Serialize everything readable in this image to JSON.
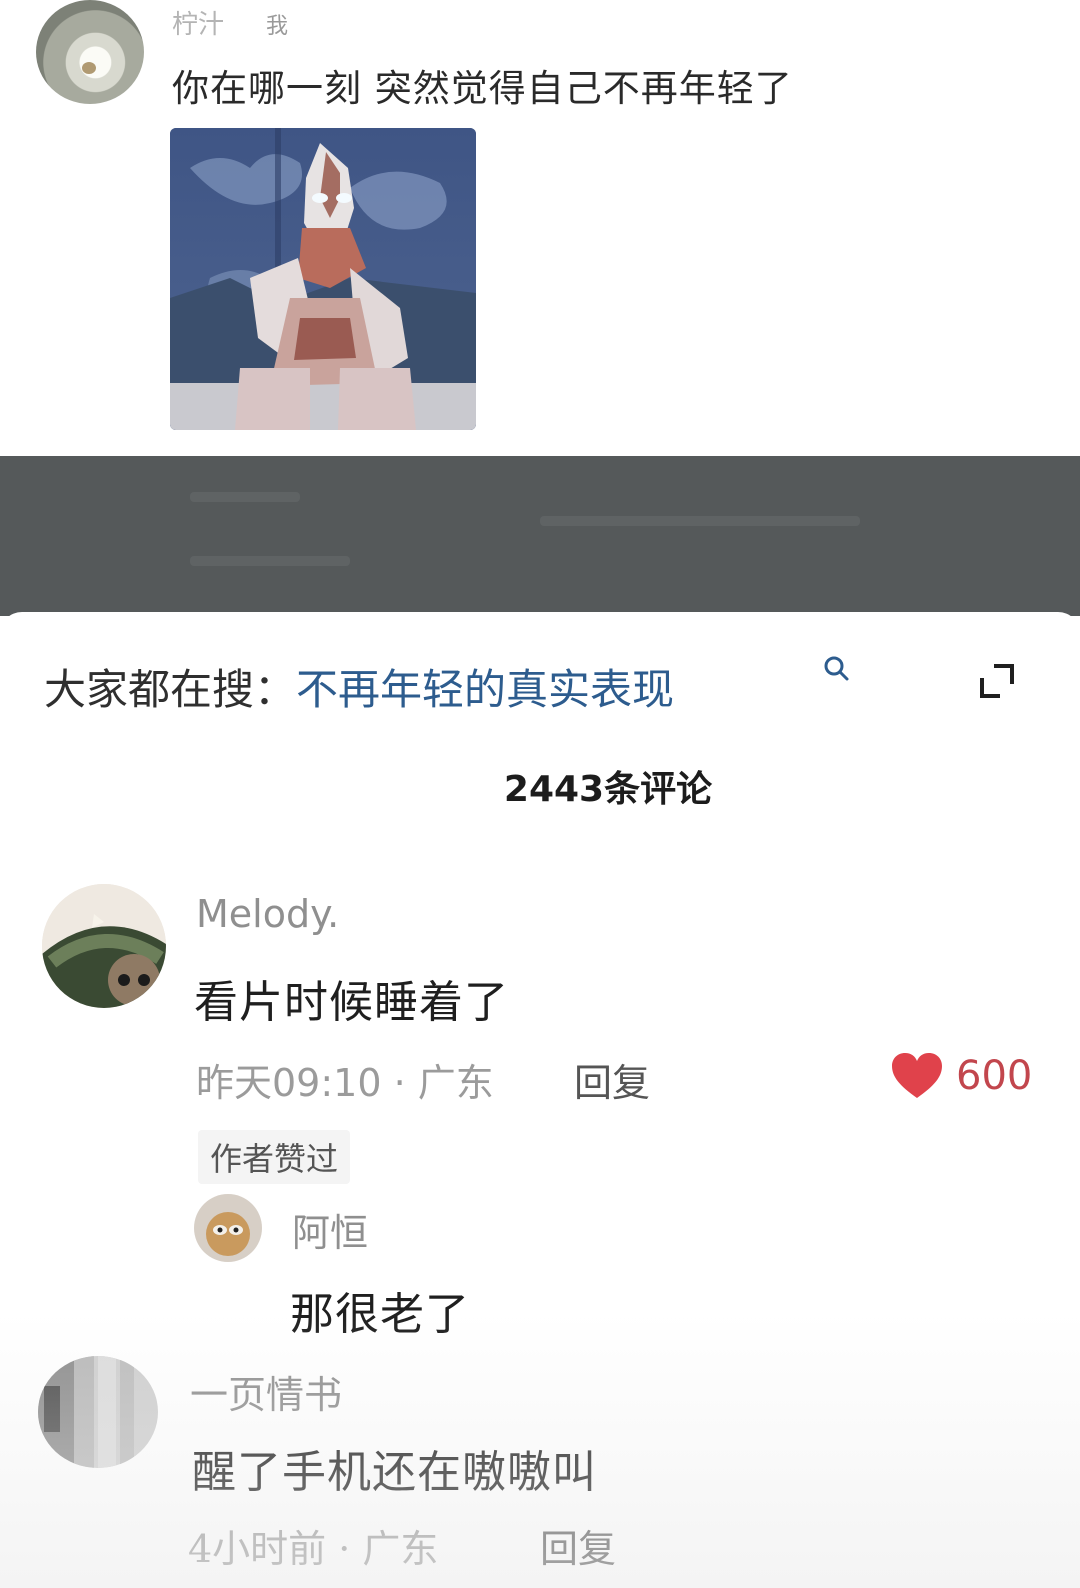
{
  "post": {
    "username": "柠汁",
    "me_tag": "我",
    "text": "你在哪一刻 突然觉得自己不再年轻了"
  },
  "search": {
    "prefix": "大家都在搜：",
    "term": "不再年轻的真实表现"
  },
  "comments_header": {
    "count_label": "2443条评论"
  },
  "comments": [
    {
      "username": "Melody.",
      "text": "看片时候睡着了",
      "meta": "昨天09:10 · 广东",
      "reply_label": "回复",
      "likes": "600",
      "badge": "作者赞过",
      "replies": [
        {
          "username": "阿恒",
          "text": "那很老了"
        }
      ]
    },
    {
      "username": "一页情书",
      "text": "醒了手机还在嗷嗷叫",
      "meta": "4小时前 · 广东",
      "reply_label": "回复"
    }
  ],
  "colors": {
    "accent_link": "#2d5c8e",
    "like_red": "#e0424b",
    "dark_band": "#55595a"
  },
  "icons": [
    "search-icon",
    "expand-icon",
    "heart-icon"
  ]
}
